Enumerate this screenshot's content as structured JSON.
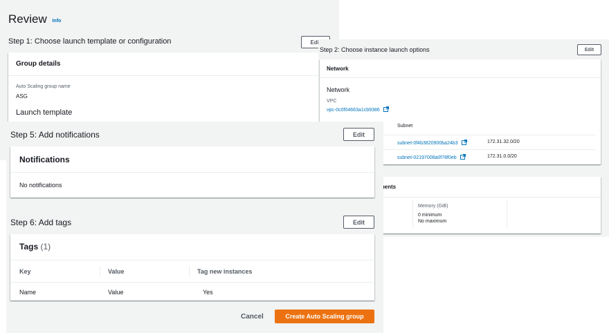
{
  "review": {
    "title": "Review",
    "info": "Info"
  },
  "step1": {
    "title": "Step 1: Choose launch template or configuration",
    "edit": "Edit",
    "card_title": "Group details",
    "asg_label": "Auto Scaling group name",
    "asg_value": "ASG",
    "launch_template": "Launch template"
  },
  "step2": {
    "title": "Step 2: Choose instance launch options",
    "edit": "Edit",
    "card_title": "Network",
    "section_title": "Network",
    "vpc_label": "VPC",
    "vpc_value": "vpc-0c0f04663a1cb9386",
    "subnet_header": "Subnet",
    "subnets": [
      {
        "id": "subnet-0f4b3820900ba24b3",
        "cidr": "172.31.32.0/20"
      },
      {
        "id": "subnet-02197008a0f78f0eb",
        "cidr": "172.31.0.0/20"
      }
    ],
    "requirements_title": "rements",
    "memory_label": "Memory (GiB)",
    "memory_min": "0 minimum",
    "memory_max": "No maximum"
  },
  "step5": {
    "title": "Step 5: Add notifications",
    "edit": "Edit",
    "card_title": "Notifications",
    "empty": "No notifications"
  },
  "step6": {
    "title": "Step 6: Add tags",
    "edit": "Edit",
    "card_title": "Tags",
    "count": "(1)",
    "columns": [
      "Key",
      "Value",
      "Tag new instances"
    ],
    "rows": [
      {
        "key": "Name",
        "value": "Value",
        "tag_new": "Yes"
      }
    ]
  },
  "footer": {
    "cancel": "Cancel",
    "create": "Create Auto Scaling group"
  },
  "colors": {
    "link": "#0073bb",
    "primary": "#ec7211",
    "panel_bg": "#f2f3f3"
  }
}
